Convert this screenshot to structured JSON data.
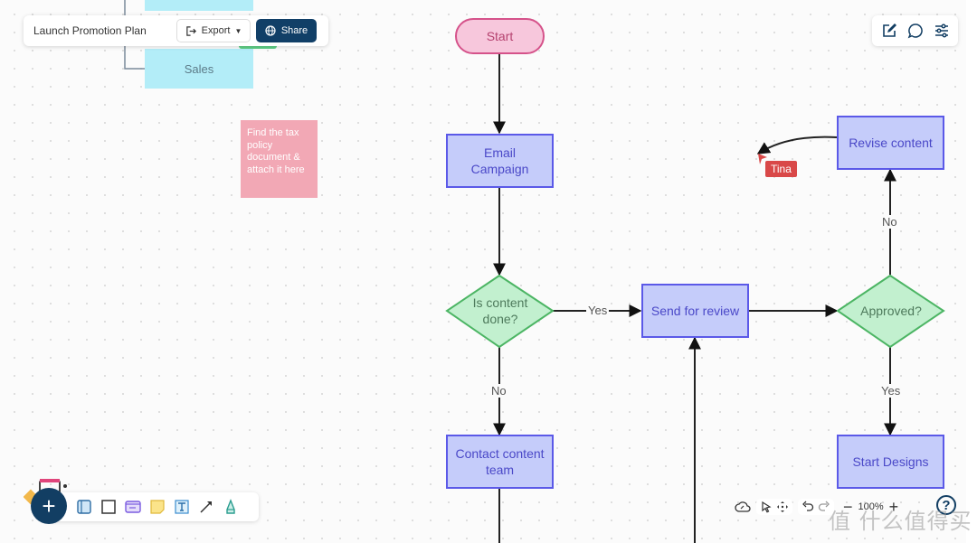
{
  "header": {
    "title": "Launch Promotion Plan",
    "export_label": "Export",
    "share_label": "Share",
    "share_color": "#113f67"
  },
  "right_tools": [
    {
      "icon": "edit-icon"
    },
    {
      "icon": "comment-icon"
    },
    {
      "icon": "settings-sliders-icon"
    }
  ],
  "background_shapes": {
    "sales_label": "Sales",
    "sticky_note_text": "Find the tax policy document & attach it here"
  },
  "flowchart": {
    "nodes": {
      "start": "Start",
      "email_campaign": "Email Campaign",
      "is_content_done": "Is content done?",
      "send_for_review": "Send for review",
      "approved": "Approved?",
      "revise_content": "Revise content",
      "start_designs": "Start Designs",
      "contact_content_team": "Contact content team"
    },
    "edge_labels": {
      "content_done_yes": "Yes",
      "content_done_no": "No",
      "approved_yes": "Yes",
      "approved_no": "No"
    },
    "colors": {
      "process_fill": "#c5ccfa",
      "process_border": "#5b59e8",
      "decision_fill": "#c2f0cf",
      "decision_border": "#4cb564",
      "terminal_fill": "#f7c7dc",
      "terminal_border": "#d5528a"
    }
  },
  "cursor": {
    "user": "Tina",
    "color": "#d94848"
  },
  "bottom_toolbar": {
    "add_label": "+",
    "tools": [
      "frame-tool-icon",
      "rectangle-tool-icon",
      "card-tool-icon",
      "sticky-note-tool-icon",
      "text-tool-icon",
      "arrow-tool-icon",
      "pen-tool-icon"
    ]
  },
  "zoom_controls": {
    "zoom_level": "100%",
    "minus": "−",
    "plus": "+",
    "help": "?"
  },
  "watermark": "值 什么值得买"
}
